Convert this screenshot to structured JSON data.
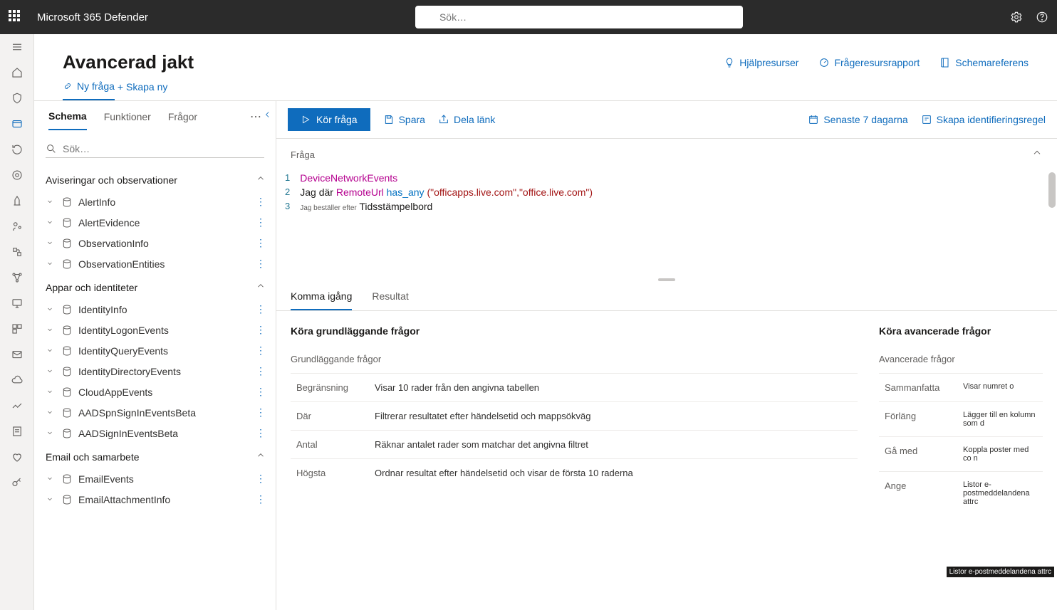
{
  "header": {
    "product": "Microsoft 365 Defender",
    "search_placeholder": "Sök…"
  },
  "page": {
    "title": "Avancerad jakt",
    "links": {
      "help": "Hjälpresurser",
      "resource": "Frågeresursrapport",
      "schemaref": "Schemareferens"
    }
  },
  "tabs": {
    "new_query": "Ny fråga",
    "create_new": "+ Skapa ny"
  },
  "schema_panel": {
    "tabs": {
      "schema": "Schema",
      "functions": "Funktioner",
      "queries": "Frågor"
    },
    "search_placeholder": "Sök…",
    "groups": [
      {
        "name": "Aviseringar och observationer",
        "tables": [
          "AlertInfo",
          "AlertEvidence",
          "ObservationInfo",
          "ObservationEntities"
        ]
      },
      {
        "name": "Appar och identiteter",
        "tables": [
          "IdentityInfo",
          "IdentityLogonEvents",
          "IdentityQueryEvents",
          "IdentityDirectoryEvents",
          "CloudAppEvents",
          "AADSpnSignInEventsBeta",
          "AADSignInEventsBeta"
        ]
      },
      {
        "name": "Email och samarbete",
        "tables": [
          "EmailEvents",
          "EmailAttachmentInfo"
        ]
      }
    ]
  },
  "toolbar": {
    "run": "Kör fråga",
    "save": "Spara",
    "share": "Dela länk",
    "last7": "Senaste 7 dagarna",
    "create_rule": "Skapa identifieringsregel"
  },
  "editor": {
    "label": "Fråga",
    "lines": {
      "l1": "DeviceNetworkEvents",
      "l2_a": "Jag där ",
      "l2_b": "RemoteUrl ",
      "l2_c": "has_any ",
      "l2_d": "(\"officapps.live.com\",\"office.live.com\")",
      "l3_a": "Jag beställer efter",
      "l3_b": " Tidsstämpelbord"
    }
  },
  "result_tabs": {
    "getting_started": "Komma igång",
    "results": "Resultat"
  },
  "getting_started": {
    "basic_heading": "Köra grundläggande frågor",
    "basic_sub": "Grundläggande frågor",
    "basic_rows": [
      {
        "k": "Begränsning",
        "v": "Visar 10 rader från den angivna tabellen"
      },
      {
        "k": "Där",
        "v": "Filtrerar resultatet efter händelsetid och mappsökväg"
      },
      {
        "k": "Antal",
        "v": "Räknar antalet rader som matchar det angivna filtret"
      },
      {
        "k": "Högsta",
        "v": "Ordnar resultat efter händelsetid och visar de första 10 raderna"
      }
    ],
    "adv_heading": "Köra avancerade frågor",
    "adv_sub": "Avancerade frågor",
    "adv_rows": [
      {
        "k": "Sammanfatta",
        "v": "Visar numret o"
      },
      {
        "k": "Förläng",
        "v": "Lägger till en kolumn som d"
      },
      {
        "k": "Gå med",
        "v": "Koppla poster med co n"
      },
      {
        "k": "Ange",
        "v": "Listor e-postmeddelandena attrc"
      }
    ]
  }
}
